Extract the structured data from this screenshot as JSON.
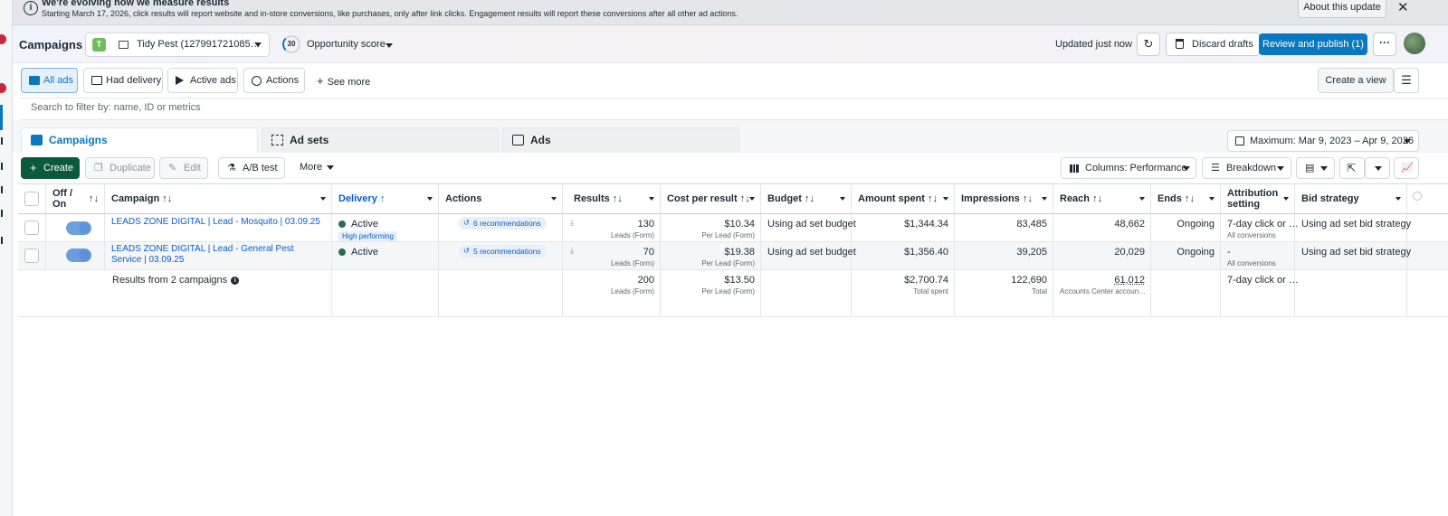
{
  "banner": {
    "title": "We're evolving how we measure results",
    "body": "Starting March 17, 2026, click results will report website and in-store conversions, like purchases, only after link clicks. Engagement results will report these conversions after all other ad actions.",
    "about_label": "About this update",
    "close_glyph": "✕"
  },
  "rail": {
    "badge_1": "5",
    "badge_2": "2"
  },
  "header": {
    "title": "Campaigns",
    "account_initial": "T",
    "account_name": "Tidy Pest (127991721085…",
    "opportunity_score": "30",
    "opportunity_label": "Opportunity score",
    "updated": "Updated just now",
    "discard_label": "Discard drafts",
    "publish_label": "Review and publish (1)",
    "more_glyph": "···"
  },
  "views": {
    "tabs": [
      {
        "label": "All ads"
      },
      {
        "label": "Had delivery"
      },
      {
        "label": "Active ads"
      },
      {
        "label": "Actions"
      }
    ],
    "see_more": "See more",
    "create_view": "Create a view"
  },
  "search": {
    "placeholder": "Search to filter by: name, ID or metrics"
  },
  "levels": {
    "tabs": [
      {
        "label": "Campaigns"
      },
      {
        "label": "Ad sets"
      },
      {
        "label": "Ads"
      }
    ],
    "date_range": "Maximum: Mar 9, 2023 – Apr 9, 2026"
  },
  "toolbar": {
    "create": "Create",
    "duplicate": "Duplicate",
    "edit": "Edit",
    "ab_test": "A/B test",
    "more": "More",
    "columns": "Columns: Performance",
    "breakdown": "Breakdown"
  },
  "table": {
    "headers": {
      "onoff": "Off / On",
      "campaign": "Campaign",
      "delivery": "Delivery",
      "actions": "Actions",
      "results": "Results",
      "cpr": "Cost per result",
      "budget": "Budget",
      "spent": "Amount spent",
      "impressions": "Impressions",
      "reach": "Reach",
      "ends": "Ends",
      "attribution": "Attribution setting",
      "bid": "Bid strategy"
    },
    "rows": [
      {
        "campaign": "LEADS ZONE DIGITAL | Lead - Mosquito | 03.09.25",
        "delivery": "Active",
        "delivery_tag": "High performing",
        "actions": "6 recommendations",
        "results": "130",
        "results_sub": "Leads (Form)",
        "cpr": "$10.34",
        "cpr_sub": "Per Lead (Form)",
        "budget": "Using ad set budget",
        "spent": "$1,344.34",
        "impressions": "83,485",
        "reach": "48,662",
        "ends": "Ongoing",
        "attribution": "7-day click or …",
        "attribution_sub": "All conversions",
        "bid": "Using ad set bid strategy"
      },
      {
        "campaign": "LEADS ZONE DIGITAL | Lead - General Pest Service | 03.09.25",
        "delivery": "Active",
        "actions": "5 recommendations",
        "results": "70",
        "results_sub": "Leads (Form)",
        "cpr": "$19.38",
        "cpr_sub": "Per Lead (Form)",
        "budget": "Using ad set budget",
        "spent": "$1,356.40",
        "impressions": "39,205",
        "reach": "20,029",
        "ends": "Ongoing",
        "attribution": "-",
        "attribution_sub": "All conversions",
        "bid": "Using ad set bid strategy"
      }
    ],
    "totals": {
      "label": "Results from 2 campaigns",
      "results": "200",
      "results_sub": "Leads (Form)",
      "cpr": "$13.50",
      "cpr_sub": "Per Lead (Form)",
      "spent": "$2,700.74",
      "spent_sub": "Total spent",
      "impressions": "122,690",
      "impressions_sub": "Total",
      "reach": "61,012",
      "reach_sub": "Accounts Center accoun…",
      "attribution": "7-day click or …"
    }
  },
  "colors": {
    "accent": "#0a78be",
    "create_green": "#0b5a3e",
    "active_dot": "#2b6d4b"
  }
}
